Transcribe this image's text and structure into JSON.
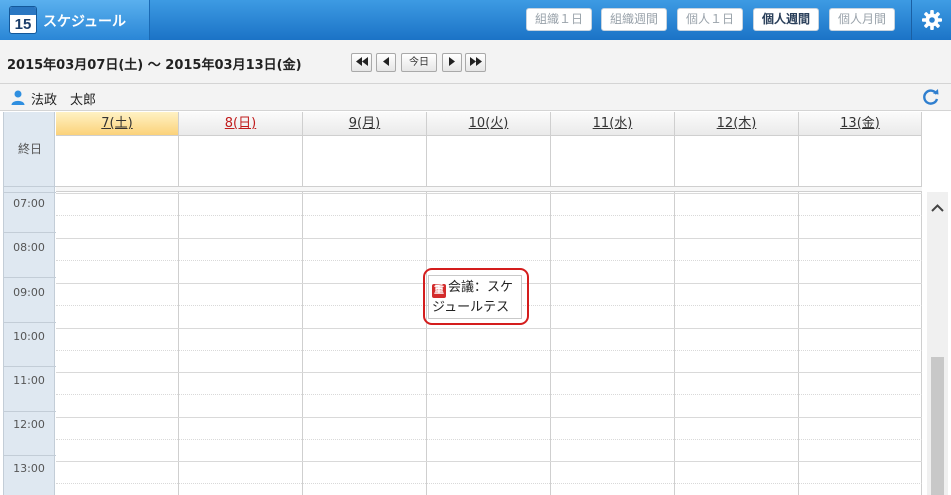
{
  "app": {
    "title": "スケジュール",
    "icon_day": "15",
    "views": [
      "組織１日",
      "組織週間",
      "個人１日",
      "個人週間",
      "個人月間"
    ],
    "active_view": "個人週間",
    "accent_color": "#1b73c6"
  },
  "toolbar": {
    "date_range": "2015年03月07日(土) ～ 2015年03月13日(金)",
    "today_label": "今日",
    "nav_icons": [
      "first-icon",
      "prev-icon",
      "next-icon",
      "last-icon"
    ]
  },
  "user": {
    "name": "法政　太郎"
  },
  "grid": {
    "allday_label": "終日",
    "days": [
      {
        "label": "7(土)",
        "type": "today"
      },
      {
        "label": "8(日)",
        "type": "sunday"
      },
      {
        "label": "9(月)",
        "type": "normal"
      },
      {
        "label": "10(火)",
        "type": "normal"
      },
      {
        "label": "11(水)",
        "type": "normal"
      },
      {
        "label": "12(木)",
        "type": "normal"
      },
      {
        "label": "13(金)",
        "type": "normal"
      }
    ],
    "times": [
      "07:00",
      "08:00",
      "09:00",
      "10:00",
      "11:00",
      "12:00",
      "13:00"
    ]
  },
  "event": {
    "badge": "重",
    "title": "会議：スケジュールテス",
    "day": "10(火)",
    "badge_color": "#d32b2b"
  }
}
